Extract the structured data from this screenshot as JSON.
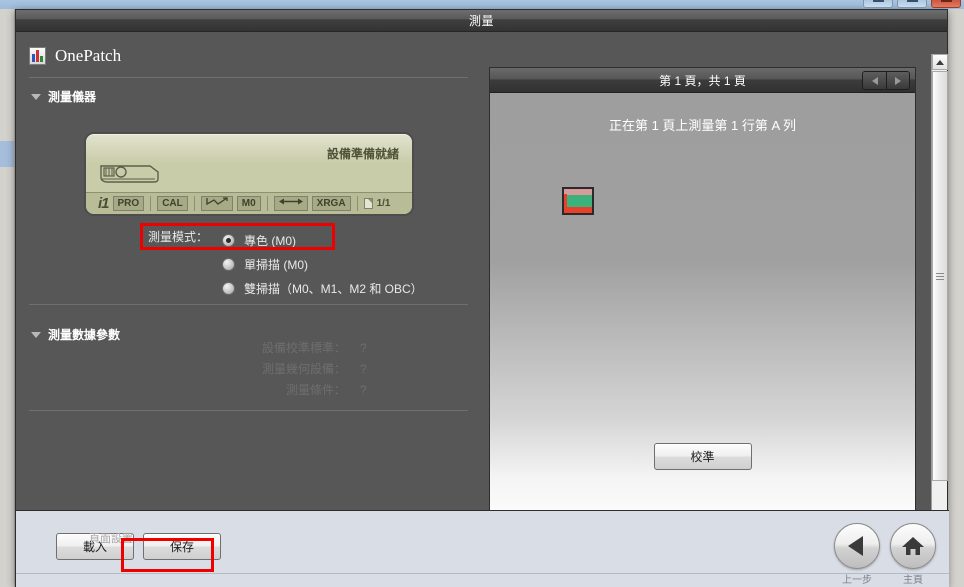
{
  "window": {
    "title": "測量",
    "controls": [
      {
        "name": "minimize-button",
        "glyph": "—"
      },
      {
        "name": "maximize-button",
        "glyph": "▭"
      },
      {
        "name": "close-button",
        "glyph": "✕"
      }
    ]
  },
  "app": {
    "name": "OnePatch",
    "icon": "chart-document-icon"
  },
  "sections": {
    "device": {
      "title": "測量儀器",
      "expanded": true,
      "status_text": "設備準備就緒",
      "device_icon": "spectrophotometer-icon",
      "status_bar": {
        "brand": "i1",
        "model": "PRO",
        "cal": "CAL",
        "chart_glyph": "measure-chart-icon",
        "mode": "M0",
        "arrow_glyph": "double-arrow-icon",
        "standard": "XRGA",
        "page_icon": "page-icon",
        "page_count": "1/1"
      }
    },
    "mode": {
      "label": "測量模式：",
      "options": [
        {
          "label": "專色 (M0)",
          "selected": true
        },
        {
          "label": "單掃描 (M0)",
          "selected": false
        },
        {
          "label": "雙掃描（M0、M1、M2 和 OBC）",
          "selected": false
        }
      ]
    },
    "params": {
      "title": "測量數據參數",
      "expanded": true,
      "disabled": true,
      "rows": [
        {
          "name": "設備校準標準：",
          "value": "?"
        },
        {
          "name": "測量幾何設備：",
          "value": "?"
        },
        {
          "name": "測量條件：",
          "value": "?"
        }
      ]
    }
  },
  "preview": {
    "page_label": "第 1 頁，共 1 頁",
    "prev_button": "prev-page-button",
    "next_button": "next-page-button",
    "status": "正在第 1 頁上測量第 1 行第 A 列",
    "patch": {
      "name": "color-patch-swatch",
      "top_color": "#d79b9e",
      "mid_color": "#3bb27c",
      "bottom_color": "#e8402a",
      "border_color": "#2a2a2a"
    },
    "calibrate_button": "校準"
  },
  "footer": {
    "faint_label": "頁面設置",
    "load_button": "載入",
    "save_button": "保存",
    "back_button": {
      "label": "上一步",
      "icon": "back-arrow-icon"
    },
    "home_button": {
      "label": "主頁",
      "icon": "home-icon"
    }
  },
  "highlights": {
    "accent_color": "#ee0000",
    "boxes": [
      "measurement-mode-row",
      "save-button"
    ]
  }
}
